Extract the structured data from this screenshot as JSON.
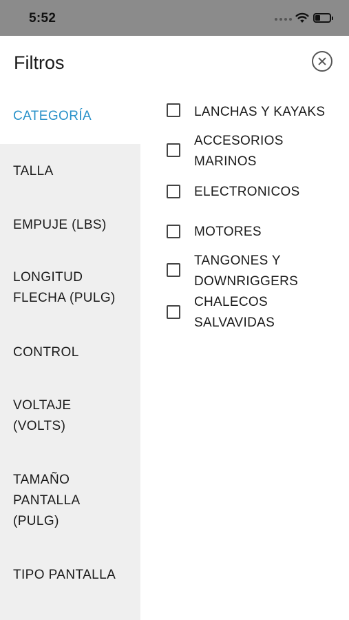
{
  "status_bar": {
    "time": "5:52",
    "battery_level": 0.35,
    "icons": [
      "cellular-dots-icon",
      "wifi-icon",
      "battery-icon"
    ]
  },
  "header": {
    "title": "Filtros",
    "close_icon": "close-circle-icon"
  },
  "sidebar": {
    "active_index": 0,
    "active_color": "#2a92c9",
    "items": [
      {
        "label": "CATEGORÍA"
      },
      {
        "label": "TALLA"
      },
      {
        "label": "EMPUJE (LBS)"
      },
      {
        "label": "LONGITUD\nFLECHA (PULG)"
      },
      {
        "label": "CONTROL"
      },
      {
        "label": "VOLTAJE\n(VOLTS)"
      },
      {
        "label": "TAMAÑO\nPANTALLA\n(PULG)"
      },
      {
        "label": "TIPO PANTALLA"
      }
    ]
  },
  "options": {
    "items": [
      {
        "label": "LANCHAS Y KAYAKS",
        "checked": false
      },
      {
        "label": "ACCESORIOS\nMARINOS",
        "checked": false
      },
      {
        "label": "ELECTRONICOS",
        "checked": false
      },
      {
        "label": "MOTORES",
        "checked": false
      },
      {
        "label": "TANGONES Y\nDOWNRIGGERS",
        "checked": false
      },
      {
        "label": "CHALECOS\nSALVAVIDAS",
        "checked": false
      }
    ]
  }
}
